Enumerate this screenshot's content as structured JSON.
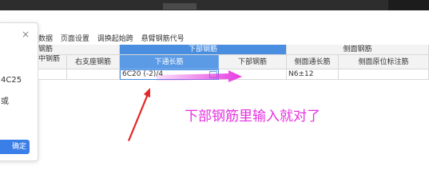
{
  "dialog": {
    "close_glyph": "×",
    "line1": "4C25",
    "line2": "或",
    "confirm_label": "确定"
  },
  "toolbar": {
    "items": [
      "数据",
      "页面设置",
      "调换起始跨",
      "悬臂钢筋代号"
    ]
  },
  "table": {
    "group_left_partial": "钢筋",
    "group_bottom": "下部钢筋",
    "group_side": "侧面钢筋",
    "col_left_partial": "中钢筋",
    "col_right_support": "右支座钢筋",
    "col_bottom_through": "下通长筋",
    "col_bottom_rebar": "下部钢筋",
    "col_side_through": "侧面通长筋",
    "col_side_original": "侧面原位标注筋",
    "row": {
      "bottom_through_value": "6C20 (-2)/4",
      "side_through_value": "N6±12"
    }
  },
  "annotation": {
    "text": "下部钢筋里输入就对了",
    "color": "#e531e0",
    "arrow_color": "#e5292a"
  }
}
